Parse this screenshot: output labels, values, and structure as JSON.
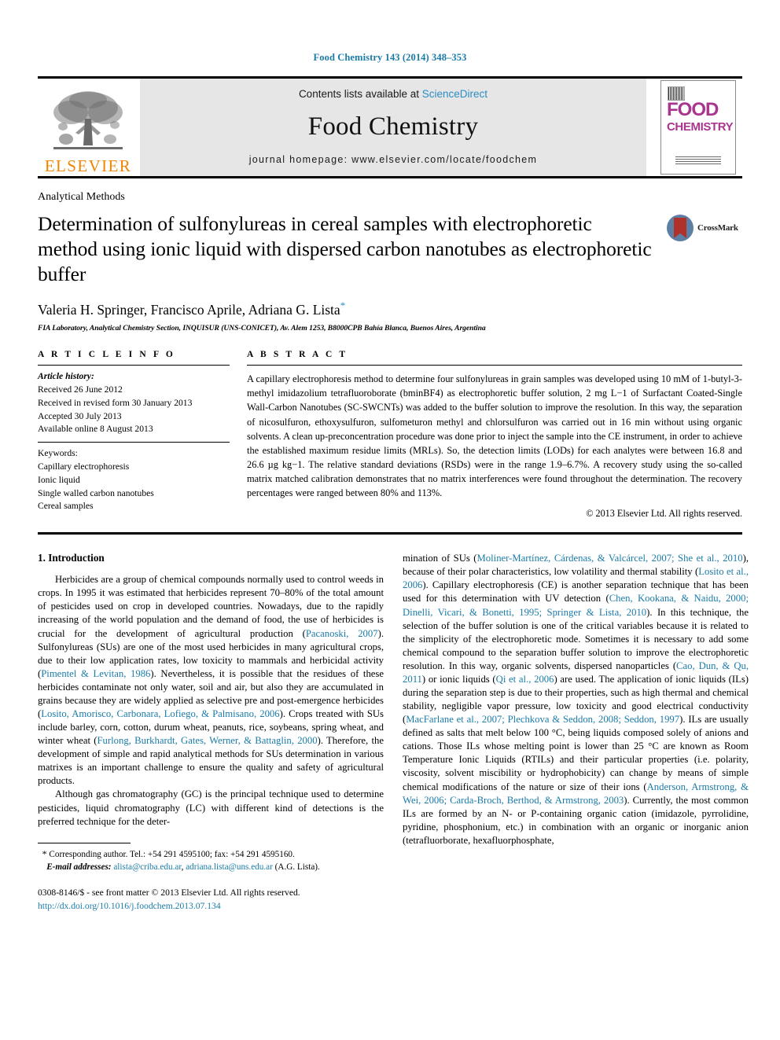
{
  "running_head": "Food Chemistry 143 (2014) 348–353",
  "masthead": {
    "publisher_name": "ELSEVIER",
    "contents_prefix": "Contents lists available at ",
    "contents_link": "ScienceDirect",
    "journal_title": "Food Chemistry",
    "homepage_line": "journal homepage: www.elsevier.com/locate/foodchem",
    "cover": {
      "word_food": "FOOD",
      "word_chemistry": "CHEMISTRY"
    }
  },
  "article": {
    "section_label": "Analytical Methods",
    "title": "Determination of sulfonylureas in cereal samples with electrophoretic method using ionic liquid with dispersed carbon nanotubes as electrophoretic buffer",
    "crossmark_label": "CrossMark",
    "authors": "Valeria H. Springer, Francisco Aprile, Adriana G. Lista",
    "corresponding_marker": "*",
    "affiliation": "FIA Laboratory, Analytical Chemistry Section, INQUISUR (UNS-CONICET), Av. Alem 1253, B8000CPB Bahía Blanca, Buenos Aires, Argentina"
  },
  "article_info": {
    "heading": "A R T I C L E   I N F O",
    "history_label": "Article history:",
    "history": [
      "Received 26 June 2012",
      "Received in revised form 30 January 2013",
      "Accepted 30 July 2013",
      "Available online 8 August 2013"
    ],
    "keywords_label": "Keywords:",
    "keywords": [
      "Capillary electrophoresis",
      "Ionic liquid",
      "Single walled carbon nanotubes",
      "Cereal samples"
    ]
  },
  "abstract": {
    "heading": "A B S T R A C T",
    "text": "A capillary electrophoresis method to determine four sulfonylureas in grain samples was developed using 10 mM of 1-butyl-3-methyl imidazolium tetrafluoroborate (bminBF4) as electrophoretic buffer solution, 2 mg L−1 of Surfactant Coated-Single Wall-Carbon Nanotubes (SC-SWCNTs) was added to the buffer solution to improve the resolution. In this way, the separation of nicosulfuron, ethoxysulfuron, sulfometuron methyl and chlorsulfuron was carried out in 16 min without using organic solvents. A clean up-preconcentration procedure was done prior to inject the sample into the CE instrument, in order to achieve the established maximum residue limits (MRLs). So, the detection limits (LODs) for each analytes were between 16.8 and 26.6 µg kg−1. The relative standard deviations (RSDs) were in the range 1.9–6.7%. A recovery study using the so-called matrix matched calibration demonstrates that no matrix interferences were found throughout the determination. The recovery percentages were ranged between 80% and 113%.",
    "copyright": "© 2013 Elsevier Ltd. All rights reserved."
  },
  "introduction": {
    "heading": "1. Introduction",
    "left_paragraph_1_a": "Herbicides are a group of chemical compounds normally used to control weeds in crops. In 1995 it was estimated that herbicides represent 70–80% of the total amount of pesticides used on crop in developed countries. Nowadays, due to the rapidly increasing of the world population and the demand of food, the use of herbicides is crucial for the development of agricultural production (",
    "cite_pacanoski": "Pacanoski, 2007",
    "left_paragraph_1_b": "). Sulfonylureas (SUs) are one of the most used herbicides in many agricultural crops, due to their low application rates, low toxicity to mammals and herbicidal activity (",
    "cite_pimentel": "Pimentel & Levitan, 1986",
    "left_paragraph_1_c": "). Nevertheless, it is possible that the residues of these herbicides contaminate not only water, soil and air, but also they are accumulated in grains because they are widely applied as selective pre and post-emergence herbicides (",
    "cite_losito": "Losito, Amorisco, Carbonara, Lofiego, & Palmisano, 2006",
    "left_paragraph_1_d": "). Crops treated with SUs include barley, corn, cotton, durum wheat, peanuts, rice, soybeans, spring wheat, and winter wheat (",
    "cite_furlong": "Furlong, Burkhardt, Gates, Werner, & Battaglin, 2000",
    "left_paragraph_1_e": "). Therefore, the development of simple and rapid analytical methods for SUs determination in various matrixes is an important challenge to ensure the quality and safety of agricultural products.",
    "left_paragraph_2": "Although gas chromatography (GC) is the principal technique used to determine pesticides, liquid chromatography (LC) with different kind of detections is the preferred technique for the deter-",
    "right_a": "mination of SUs (",
    "cite_moliner": "Moliner-Martínez, Cárdenas, & Valcárcel, 2007; She et al., 2010",
    "right_b": "), because of their polar characteristics, low volatility and thermal stability (",
    "cite_losito_etal": "Losito et al., 2006",
    "right_c": "). Capillary electrophoresis (CE) is another separation technique that has been used for this determination with UV detection (",
    "cite_chen": "Chen, Kookana, & Naidu, 2000; Dinelli, Vicari, & Bonetti, 1995; Springer & Lista, 2010",
    "right_d": "). In this technique, the selection of the buffer solution is one of the critical variables because it is related to the simplicity of the electrophoretic mode. Sometimes it is necessary to add some chemical compound to the separation buffer solution to improve the electrophoretic resolution. In this way, organic solvents, dispersed nanoparticles (",
    "cite_cao": "Cao, Dun, & Qu, 2011",
    "right_e": ") or ionic liquids (",
    "cite_qi": "Qi et al., 2006",
    "right_f": ") are used. The application of ionic liquids (ILs) during the separation step is due to their properties, such as high thermal and chemical stability, negligible vapor pressure, low toxicity and good electrical conductivity (",
    "cite_macfarlane": "MacFarlane et al., 2007; Plechkova & Seddon, 2008; Seddon, 1997",
    "right_g": "). ILs are usually defined as salts that melt below 100 °C, being liquids composed solely of anions and cations. Those ILs whose melting point is lower than 25 °C are known as Room Temperature Ionic Liquids (RTILs) and their particular properties (i.e. polarity, viscosity, solvent miscibility or hydrophobicity) can change by means of simple chemical modifications of the nature or size of their ions (",
    "cite_anderson": "Anderson, Armstrong, & Wei, 2006; Carda-Broch, Berthod, & Armstrong, 2003",
    "right_h": "). Currently, the most common ILs are formed by an N- or P-containing organic cation (imidazole, pyrrolidine, pyridine, phosphonium, etc.) in combination with an organic or inorganic anion (tetrafluorborate, hexafluorphosphate,"
  },
  "footnotes": {
    "corresponding_marker": "*",
    "corresponding_text": " Corresponding author. Tel.: +54 291 4595100; fax: +54 291 4595160.",
    "email_label": "E-mail addresses:",
    "email_1": "alista@criba.edu.ar",
    "email_sep": ", ",
    "email_2": "adriana.lista@uns.edu.ar",
    "email_suffix": " (A.G. Lista).",
    "imprint": "0308-8146/$ - see front matter © 2013 Elsevier Ltd. All rights reserved.",
    "doi": "http://dx.doi.org/10.1016/j.foodchem.2013.07.134"
  },
  "colors": {
    "link": "#1b7ba8",
    "sciencedirect": "#2b8cc4",
    "elsevier_orange": "#f08400",
    "cover_magenta": "#a8368f",
    "crossmark_red": "#b0312a",
    "crossmark_blue": "#5d7fa4"
  }
}
